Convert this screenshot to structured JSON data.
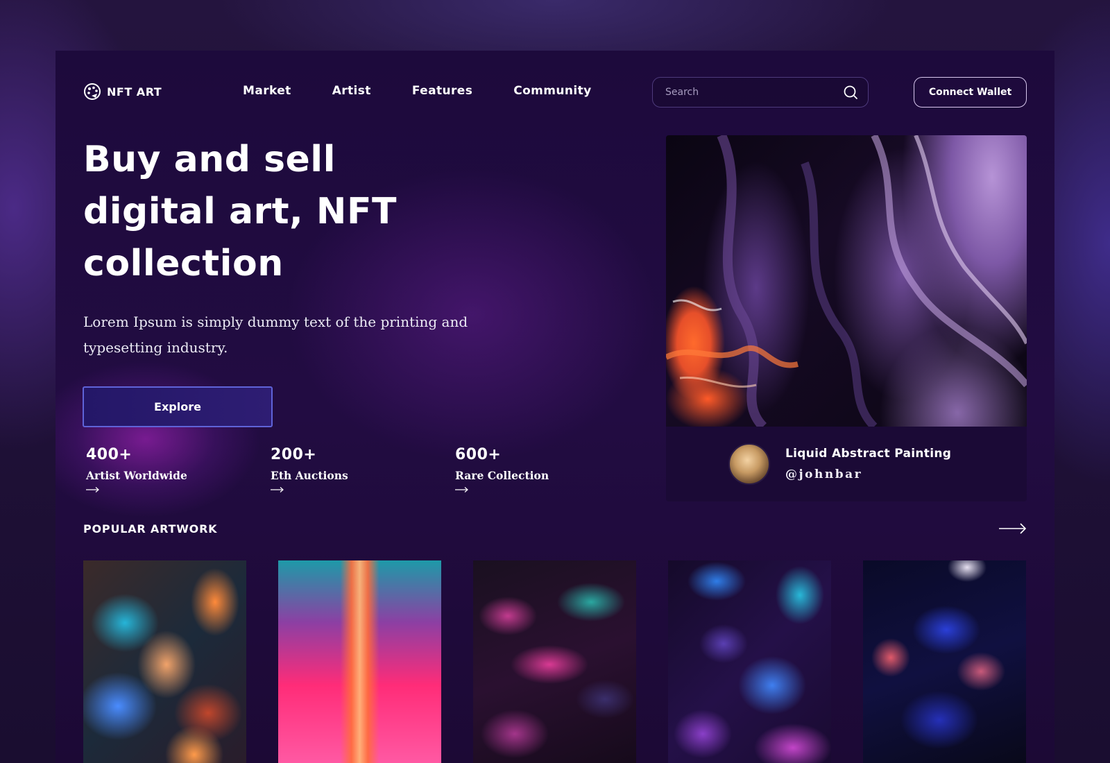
{
  "brand": {
    "name": "NFT ART"
  },
  "nav": {
    "items": [
      {
        "label": "Market"
      },
      {
        "label": "Artist"
      },
      {
        "label": "Features"
      },
      {
        "label": "Community"
      }
    ]
  },
  "search": {
    "placeholder": "Search",
    "icon": "search-icon"
  },
  "header": {
    "wallet_label": "Connect Wallet"
  },
  "hero": {
    "title": "Buy and sell digital art, NFT collection",
    "subtitle": "Lorem Ipsum is simply dummy text of the printing and typesetting industry.",
    "cta_label": "Explore"
  },
  "stats": [
    {
      "value": "400+",
      "label": "Artist Worldwide"
    },
    {
      "value": "200+",
      "label": "Eth Auctions"
    },
    {
      "value": "600+",
      "label": "Rare Collection"
    }
  ],
  "featured": {
    "title": "Liquid Abstract Painting",
    "author": "@johnbar"
  },
  "popular": {
    "title": "POPULAR ARTWORK",
    "artworks": [
      "artwork-1",
      "artwork-2",
      "artwork-3",
      "artwork-4",
      "artwork-5"
    ]
  },
  "colors": {
    "background": "#1d0a3c",
    "accent_border": "#5f63d8",
    "button_fill": "#241768",
    "featured_panel": "#1b0a36"
  }
}
